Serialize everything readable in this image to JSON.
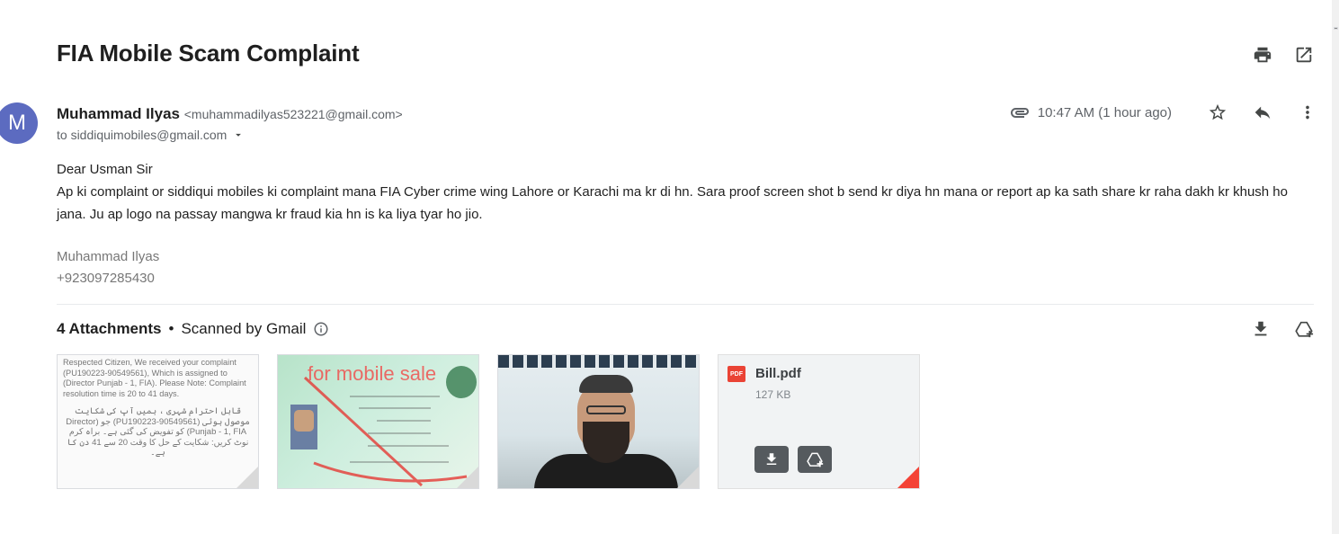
{
  "email": {
    "subject": "FIA Mobile Scam Complaint",
    "sender_name": "Muhammad Ilyas",
    "sender_email": "<muhammadilyas523221@gmail.com>",
    "recipient": "to siddiquimobiles@gmail.com",
    "avatar_letter": "M",
    "time": "10:47 AM (1 hour ago)",
    "greeting": "Dear Usman Sir",
    "body": "Ap ki complaint or siddiqui mobiles ki complaint mana FIA Cyber crime wing Lahore or Karachi ma kr di hn. Sara proof screen shot b send kr diya hn mana or report ap ka sath share kr raha dakh kr khush ho jana. Ju ap logo na passay mangwa kr fraud kia hn is ka liya tyar ho jio.",
    "signature_name": "Muhammad Ilyas",
    "signature_phone": "+923097285430"
  },
  "attachments": {
    "count_label": "4 Attachments",
    "separator": "•",
    "scanned_label": "Scanned by Gmail",
    "items": [
      {
        "type": "image",
        "name": "complaint-screenshot",
        "text_en": "Respected Citizen, We received your complaint (PU190223-90549561), Which is assigned to (Director Punjab - 1, FIA). Please Note: Complaint resolution time is 20 to 41 days.",
        "text_ur": "قابل احترام شہری ، ہمیں آپ کی شکایت موصول ہوئی (PU190223-90549561) جو (Director Punjab - 1, FIA) کو تفویض کی گئی ہے۔ براہ کرم نوٹ کریں: شکایت کے حل کا وقت 20 سے 41 دن کا ہے۔"
      },
      {
        "type": "image",
        "name": "id-card",
        "watermark": "for mobile sale"
      },
      {
        "type": "image",
        "name": "person-photo"
      },
      {
        "type": "pdf",
        "filename": "Bill.pdf",
        "size": "127 KB",
        "badge": "PDF"
      }
    ]
  },
  "colors": {
    "avatar": "#5c6bc0",
    "pdf_badge": "#ea4335",
    "pdf_corner": "#f44336"
  },
  "icons": [
    "print-icon",
    "open-new-window-icon",
    "attachment-icon",
    "star-icon",
    "reply-icon",
    "more-vert-icon",
    "chevron-down-icon",
    "info-icon",
    "download-icon",
    "add-to-drive-icon"
  ]
}
